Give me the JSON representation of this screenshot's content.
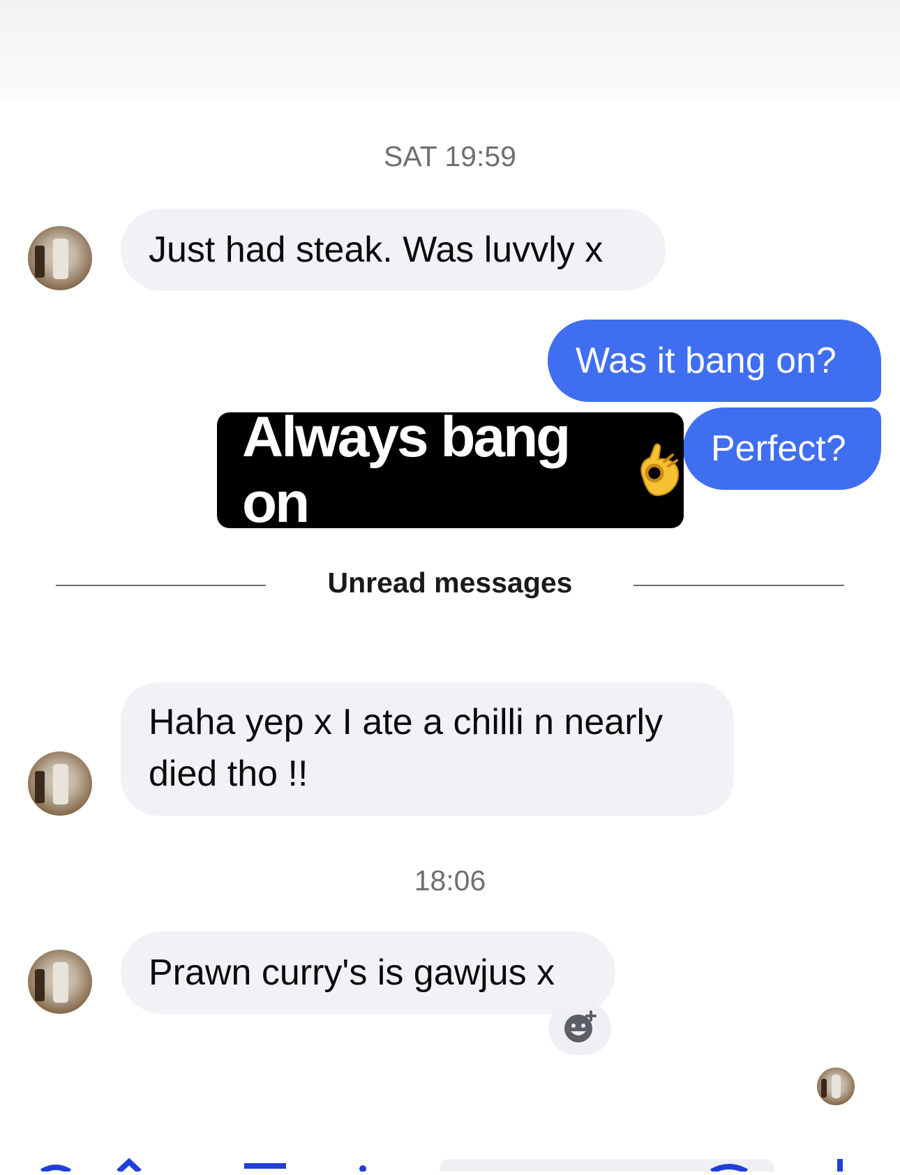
{
  "colors": {
    "incoming_bubble": "#f1f2f6",
    "outgoing_bubble": "#3f6ef0",
    "sticker_bg": "#000000",
    "timestamp_text": "#6e6e73"
  },
  "thread": {
    "timestamp_1": "SAT 19:59",
    "msg_1": "Just had steak. Was luvvly x",
    "msg_2": "Was it bang on?",
    "sticker_text": "Always bang on",
    "sticker_emoji": "ok-hand",
    "msg_3": "Perfect?",
    "unread_label": "Unread messages",
    "msg_4_line1": "Haha yep x I ate a chilli n nearly",
    "msg_4_line2": "died tho !!",
    "timestamp_2": "18:06",
    "msg_5": "Prawn curry's is gawjus x",
    "reaction_icon": "add-reaction-icon"
  }
}
